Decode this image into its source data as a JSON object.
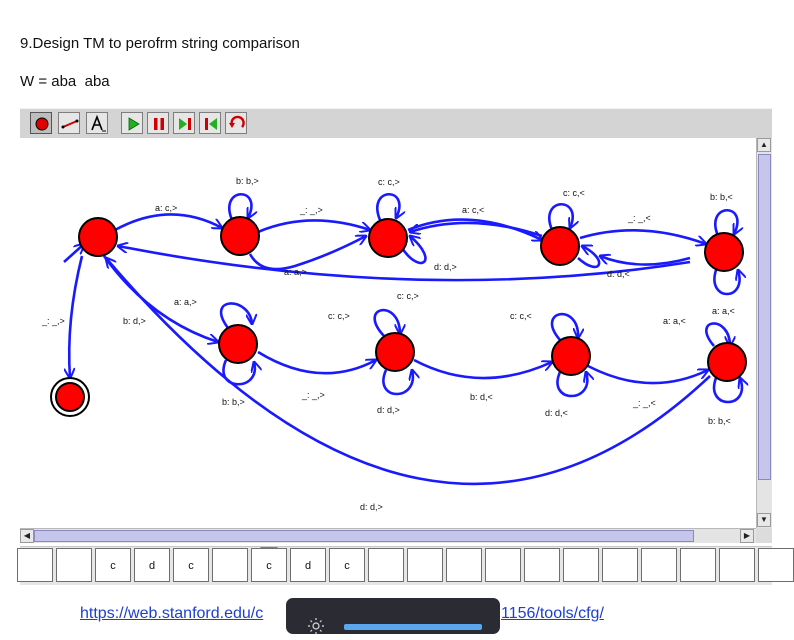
{
  "heading": "9.Design TM to perofrm string comparison",
  "word": "W = aba  aba",
  "toolbar": {
    "buttons": [
      "state-tool",
      "transition-tool",
      "label-tool",
      "play",
      "pause",
      "step",
      "reset",
      "undo"
    ]
  },
  "diagram": {
    "states": [
      {
        "id": "q0",
        "initial": true,
        "final": false
      },
      {
        "id": "q1"
      },
      {
        "id": "q2"
      },
      {
        "id": "q3"
      },
      {
        "id": "q4"
      },
      {
        "id": "q5"
      },
      {
        "id": "q6"
      },
      {
        "id": "q7"
      },
      {
        "id": "q8"
      },
      {
        "id": "qf",
        "final": true
      }
    ],
    "transitions": [
      {
        "from": "q0",
        "to": "q1",
        "label": "a: c,>"
      },
      {
        "from": "q1",
        "to": "q1",
        "label": "b: b,>"
      },
      {
        "from": "q1",
        "to": "q2",
        "label": "_: _,>"
      },
      {
        "from": "q2",
        "to": "q2",
        "label": "c: c,>"
      },
      {
        "from": "q2",
        "to": "q3",
        "label": "a: c,<"
      },
      {
        "from": "q3",
        "to": "q3",
        "label": "c: c,<"
      },
      {
        "from": "q3",
        "to": "q4",
        "label": "_: _,<"
      },
      {
        "from": "q4",
        "to": "q4",
        "label": "b: b,<"
      },
      {
        "from": "q4",
        "to": "q4",
        "label": "a: a,<"
      },
      {
        "from": "q4",
        "to": "q3",
        "label": "d: d,<"
      },
      {
        "from": "q2",
        "to": "q2",
        "label": "d: d,>"
      },
      {
        "from": "q1",
        "to": "q1",
        "label": "a: a,>"
      },
      {
        "from": "q4",
        "to": "q0",
        "label": "c: c,>"
      },
      {
        "from": "q0",
        "to": "q5",
        "label": "b: d,>"
      },
      {
        "from": "q5",
        "to": "q5",
        "label": "a: a,>"
      },
      {
        "from": "q5",
        "to": "q5",
        "label": "b: b,>"
      },
      {
        "from": "q5",
        "to": "q6",
        "label": "_: _,>"
      },
      {
        "from": "q6",
        "to": "q6",
        "label": "c: c,>"
      },
      {
        "from": "q6",
        "to": "q6",
        "label": "d: d,>"
      },
      {
        "from": "q6",
        "to": "q7",
        "label": "b: d,<"
      },
      {
        "from": "q7",
        "to": "q7",
        "label": "c: c,<"
      },
      {
        "from": "q7",
        "to": "q7",
        "label": "d: d,<"
      },
      {
        "from": "q7",
        "to": "q8",
        "label": "_: _,<"
      },
      {
        "from": "q8",
        "to": "q8",
        "label": "a: a,<"
      },
      {
        "from": "q8",
        "to": "q8",
        "label": "b: b,<"
      },
      {
        "from": "q8",
        "to": "q0",
        "label": "d: d,>"
      },
      {
        "from": "q0",
        "to": "qf",
        "label": "_: _,>"
      }
    ]
  },
  "tape": {
    "cells": [
      "",
      "",
      "c",
      "d",
      "c",
      "",
      "c",
      "d",
      "c",
      "",
      "",
      "",
      "",
      "",
      "",
      "",
      "",
      "",
      "",
      ""
    ],
    "head_index": 6
  },
  "link": {
    "prefix": "https://web.stanford.edu/c",
    "suffix": "1156/tools/cfg/"
  },
  "colors": {
    "state_fill": "#ff0000",
    "edge": "#1a1aff",
    "accent": "#20c020"
  }
}
